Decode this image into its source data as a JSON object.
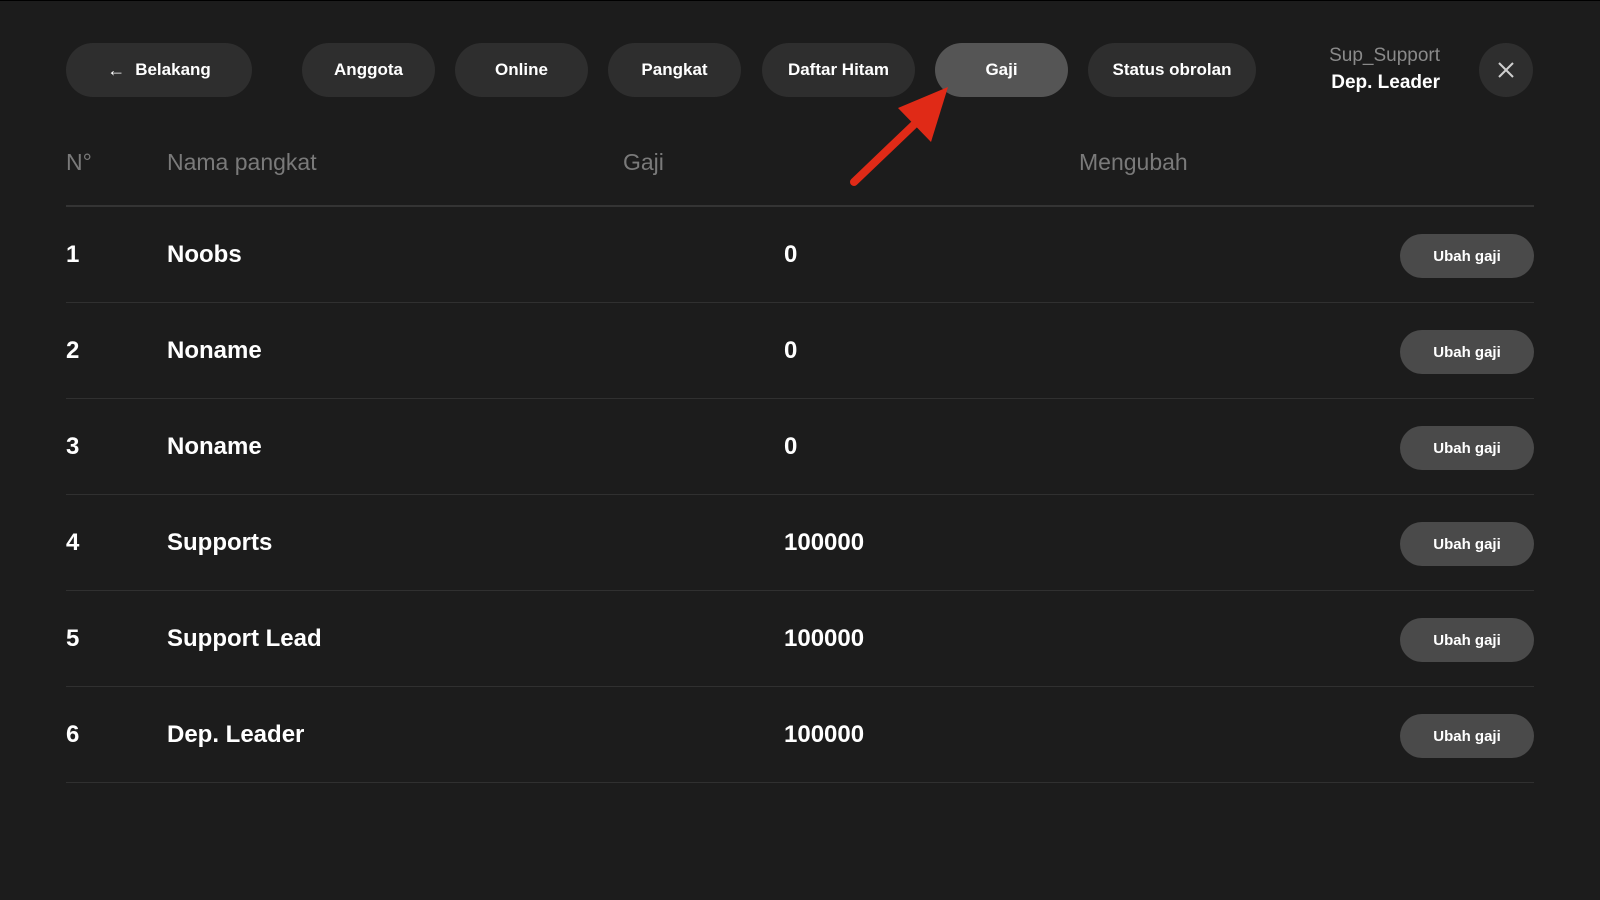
{
  "nav": {
    "back_label": "Belakang",
    "tabs": [
      {
        "label": "Anggota",
        "active": false
      },
      {
        "label": "Online",
        "active": false
      },
      {
        "label": "Pangkat",
        "active": false
      },
      {
        "label": "Daftar Hitam",
        "active": false
      },
      {
        "label": "Gaji",
        "active": true
      },
      {
        "label": "Status obrolan",
        "active": false
      }
    ],
    "user_name": "Sup_Support",
    "user_rank": "Dep. Leader"
  },
  "table": {
    "headers": {
      "no": "N°",
      "rank_name": "Nama pangkat",
      "salary": "Gaji",
      "change": "Mengubah"
    },
    "rows": [
      {
        "no": "1",
        "rank": "Noobs",
        "salary": "0",
        "action": "Ubah gaji"
      },
      {
        "no": "2",
        "rank": "Noname",
        "salary": "0",
        "action": "Ubah gaji"
      },
      {
        "no": "3",
        "rank": "Noname",
        "salary": "0",
        "action": "Ubah gaji"
      },
      {
        "no": "4",
        "rank": "Supports",
        "salary": "100000",
        "action": "Ubah gaji"
      },
      {
        "no": "5",
        "rank": "Support Lead",
        "salary": "100000",
        "action": "Ubah gaji"
      },
      {
        "no": "6",
        "rank": "Dep. Leader",
        "salary": "100000",
        "action": "Ubah gaji"
      }
    ]
  },
  "colors": {
    "background": "#1c1c1c",
    "pill": "#2e2e2e",
    "pill_active": "#555555",
    "row_button": "#4a4a4a",
    "annotation_arrow": "#e02a17"
  },
  "icons": {
    "back": "arrow-left-icon",
    "close": "close-icon",
    "annotation": "red-pointer-arrow"
  }
}
